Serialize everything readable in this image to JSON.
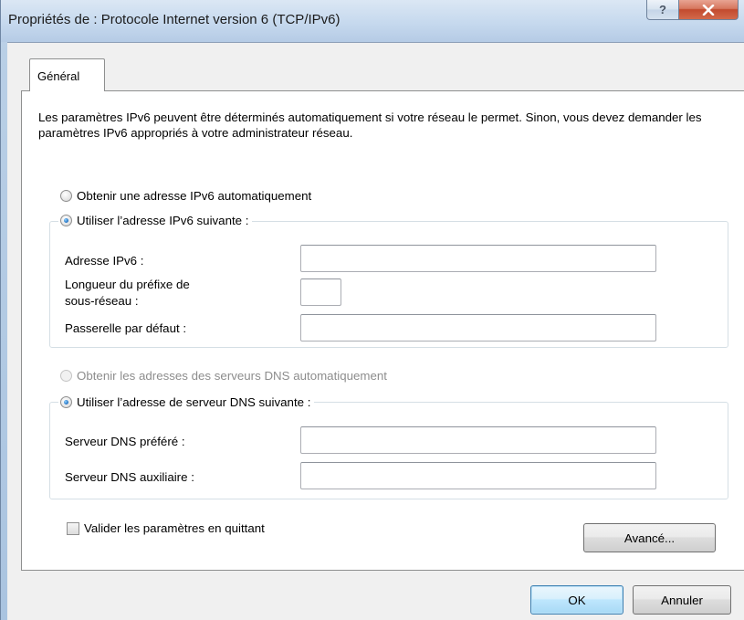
{
  "window": {
    "title": "Propriétés de : Protocole Internet version 6 (TCP/IPv6)",
    "help_glyph": "?",
    "close_glyph": "x"
  },
  "tabs": [
    {
      "label": "Général"
    }
  ],
  "general": {
    "description": "Les paramètres IPv6 peuvent être déterminés automatiquement si votre réseau le permet. Sinon, vous devez demander les paramètres IPv6 appropriés à votre administrateur réseau.",
    "ip_auto_label": "Obtenir une adresse IPv6 automatiquement",
    "ip_manual_label": "Utiliser l’adresse IPv6 suivante :",
    "ip_mode_selected": "manual",
    "ipv6_address_label": "Adresse IPv6 :",
    "ipv6_address_value": "",
    "prefix_label_line1": "Longueur du préfixe de",
    "prefix_label_line2": "sous-réseau :",
    "prefix_value": "",
    "gateway_label": "Passerelle par défaut :",
    "gateway_value": "",
    "dns_auto_label": "Obtenir les adresses des serveurs DNS automatiquement",
    "dns_auto_enabled": false,
    "dns_manual_label": "Utiliser l’adresse de serveur DNS suivante :",
    "dns_mode_selected": "manual",
    "dns_preferred_label": "Serveur DNS préféré :",
    "dns_preferred_value": "",
    "dns_alternate_label": "Serveur DNS auxiliaire :",
    "dns_alternate_value": "",
    "validate_label": "Valider les paramètres en quittant",
    "validate_checked": false,
    "advanced_label": "Avancé..."
  },
  "footer": {
    "ok_label": "OK",
    "cancel_label": "Annuler"
  },
  "colors": {
    "title_bar": "#c6d9ee",
    "close_button": "#c24a2e",
    "dialog_bg": "#f0f0f0",
    "default_button": "#bee6fd"
  }
}
